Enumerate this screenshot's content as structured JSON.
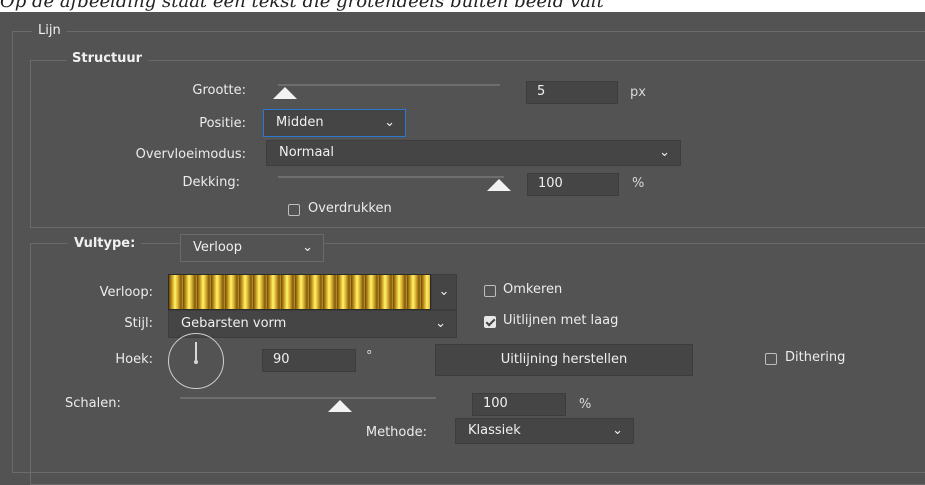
{
  "top_caption": "Op de afbeelding staat een tekst die grotendeels buiten beeld valt",
  "groups": {
    "lijn": "Lijn",
    "structuur": "Structuur",
    "vultype_label": "Vultype:"
  },
  "structuur": {
    "grootte_label": "Grootte:",
    "grootte_value": "5",
    "grootte_unit": "px",
    "grootte_slider": 0.02,
    "positie_label": "Positie:",
    "positie_value": "Midden",
    "overvloeimodus_label": "Overvloeimodus:",
    "overvloeimodus_value": "Normaal",
    "dekking_label": "Dekking:",
    "dekking_value": "100",
    "dekking_unit": "%",
    "dekking_slider": 1.0,
    "overdrukken_label": "Overdrukken",
    "overdrukken_checked": false
  },
  "vultype": {
    "value": "Verloop",
    "verloop_label": "Verloop:",
    "omkeren_label": "Omkeren",
    "omkeren_checked": false,
    "stijl_label": "Stijl:",
    "stijl_value": "Gebarsten vorm",
    "uitlijnen_label": "Uitlijnen met laag",
    "uitlijnen_checked": true,
    "hoek_label": "Hoek:",
    "hoek_value": "90",
    "hoek_unit": "°",
    "reset_button": "Uitlijning herstellen",
    "dithering_label": "Dithering",
    "dithering_checked": false,
    "schalen_label": "Schalen:",
    "schalen_value": "100",
    "schalen_unit": "%",
    "schalen_slider": 0.6,
    "methode_label": "Methode:",
    "methode_value": "Klassiek"
  },
  "icons": {
    "dropdown": "chevron-down-icon",
    "slider_thumb": "triangle-thumb-icon",
    "checkmark": "check-icon",
    "angle_dial": "angle-dial-icon"
  },
  "colors": {
    "panel_bg": "#535353",
    "field_bg": "#454545",
    "focus_border": "#2e77cf",
    "gradient_gold": "#d9aa2a"
  }
}
